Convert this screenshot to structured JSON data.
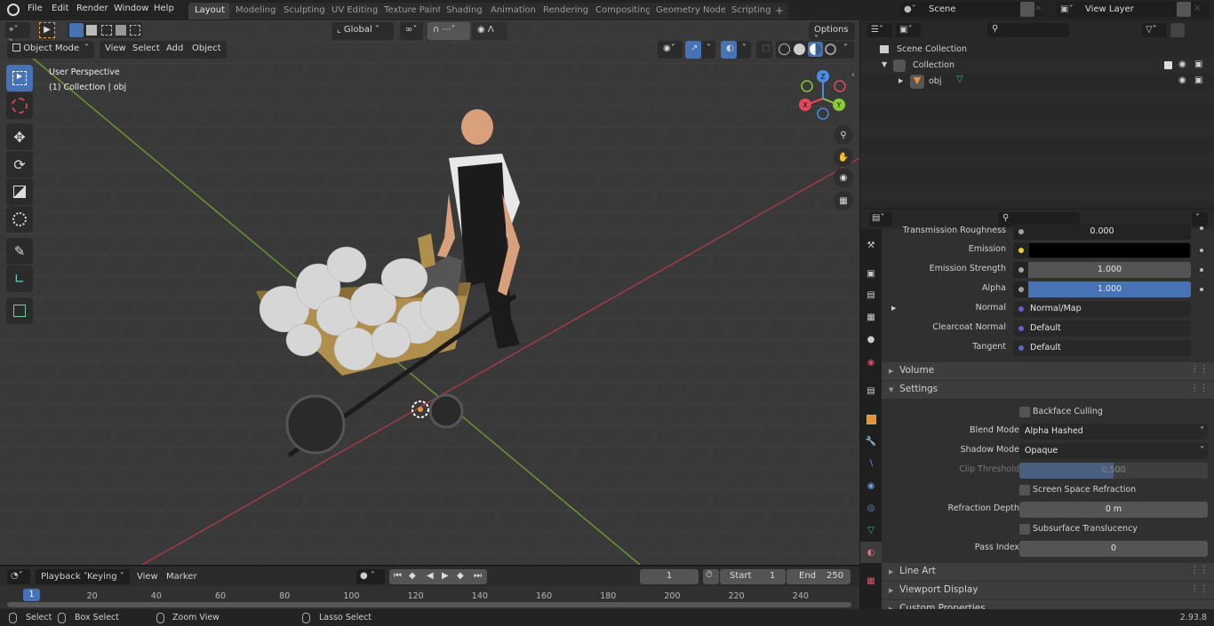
{
  "topbar": {
    "menus": [
      "File",
      "Edit",
      "Render",
      "Window",
      "Help"
    ],
    "workspaces": [
      "Layout",
      "Modeling",
      "Sculpting",
      "UV Editing",
      "Texture Paint",
      "Shading",
      "Animation",
      "Rendering",
      "Compositing",
      "Geometry Nodes",
      "Scripting"
    ],
    "active_workspace": "Layout",
    "add_workspace": "+",
    "scene": "Scene",
    "view_layer": "View Layer"
  },
  "viewport": {
    "mode": "Object Mode",
    "menus": [
      "View",
      "Select",
      "Add",
      "Object"
    ],
    "transform_orientation": "Global",
    "options_label": "Options",
    "overlay_title": "User Perspective",
    "overlay_subtitle": "(1) Collection | obj",
    "gizmo": {
      "x": "X",
      "y": "Y",
      "z": "Z"
    },
    "colors": {
      "x_axis": "#a23a48",
      "y_axis": "#6a9630",
      "accent": "#4772b3"
    }
  },
  "tools": [
    "select-box",
    "cursor",
    "move",
    "rotate",
    "scale",
    "transform",
    "annotate",
    "measure",
    "add-cube"
  ],
  "outliner": {
    "items": [
      {
        "label": "Scene Collection",
        "level": 0
      },
      {
        "label": "Collection",
        "level": 1
      },
      {
        "label": "obj",
        "level": 2
      }
    ]
  },
  "properties": {
    "rows": [
      {
        "label": "Transmission Roughness",
        "value": "0.000",
        "type": "number"
      },
      {
        "label": "Emission",
        "value": "",
        "type": "color",
        "color": "#000000"
      },
      {
        "label": "Emission Strength",
        "value": "1.000",
        "type": "number"
      },
      {
        "label": "Alpha",
        "value": "1.000",
        "type": "slider",
        "fraction": 1.0
      },
      {
        "label": "Normal",
        "value": "Normal/Map",
        "type": "link"
      },
      {
        "label": "Clearcoat Normal",
        "value": "Default",
        "type": "link"
      },
      {
        "label": "Tangent",
        "value": "Default",
        "type": "link"
      }
    ],
    "panels": {
      "volume": "Volume",
      "settings": "Settings",
      "line_art": "Line Art",
      "viewport_display": "Viewport Display",
      "custom_properties": "Custom Properties"
    },
    "settings": {
      "backface_culling": {
        "label": "Backface Culling",
        "checked": false
      },
      "blend_mode": {
        "label": "Blend Mode",
        "value": "Alpha Hashed"
      },
      "shadow_mode": {
        "label": "Shadow Mode",
        "value": "Opaque"
      },
      "clip_threshold": {
        "label": "Clip Threshold",
        "value": "0.500",
        "fraction": 0.5
      },
      "screen_space_refraction": {
        "label": "Screen Space Refraction",
        "checked": false
      },
      "refraction_depth": {
        "label": "Refraction Depth",
        "value": "0 m"
      },
      "subsurface_translucency": {
        "label": "Subsurface Translucency",
        "checked": false
      },
      "pass_index": {
        "label": "Pass Index",
        "value": "0"
      }
    }
  },
  "timeline": {
    "menus": [
      "Playback",
      "Keying",
      "View",
      "Marker"
    ],
    "current_frame": "1",
    "start_label": "Start",
    "start": "1",
    "end_label": "End",
    "end": "250",
    "ticks": [
      "20",
      "40",
      "60",
      "80",
      "100",
      "120",
      "140",
      "160",
      "180",
      "200",
      "220",
      "240"
    ],
    "playhead": "1"
  },
  "statusbar": {
    "hints": [
      "Select",
      "Box Select",
      "Zoom View",
      "Lasso Select"
    ],
    "version": "2.93.8"
  }
}
